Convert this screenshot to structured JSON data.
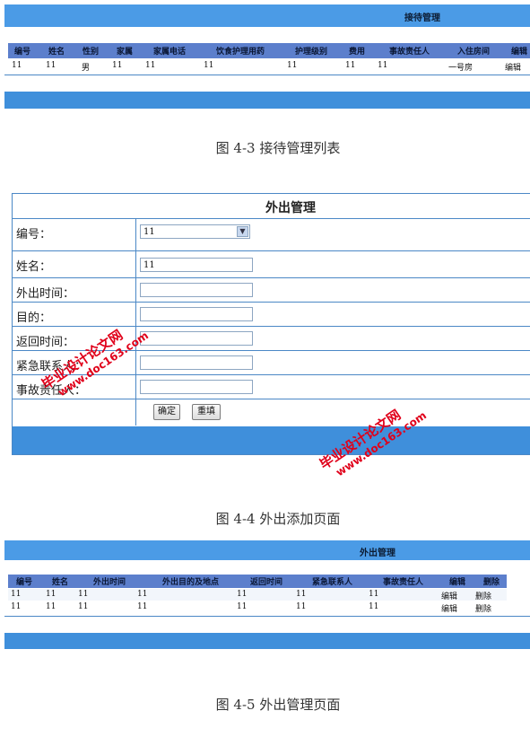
{
  "section1": {
    "title": "接待管理",
    "headers": [
      "编号",
      "姓名",
      "性别",
      "家属",
      "家属电话",
      "饮食护理用药",
      "护理级别",
      "费用",
      "事故责任人",
      "入住房间",
      "编辑"
    ],
    "rows": [
      [
        "11",
        "11",
        "男",
        "11",
        "11",
        "11",
        "11",
        "11",
        "11",
        "一号房",
        "编辑"
      ]
    ],
    "caption": "图 4-3 接待管理列表"
  },
  "section2": {
    "title": "外出管理",
    "fields": [
      {
        "label": "编号：",
        "value": "11"
      },
      {
        "label": "姓名：",
        "value": "11"
      },
      {
        "label": "外出时间：",
        "value": ""
      },
      {
        "label": "目的：",
        "value": ""
      },
      {
        "label": "返回时间：",
        "value": ""
      },
      {
        "label": "紧急联系人：",
        "value": ""
      },
      {
        "label": "事故责任人：",
        "value": ""
      }
    ],
    "confirm_label": "确定",
    "reset_label": "重填",
    "caption": "图 4-4 外出添加页面"
  },
  "section3": {
    "title": "外出管理",
    "headers": [
      "编号",
      "姓名",
      "外出时间",
      "外出目的及地点",
      "返回时间",
      "紧急联系人",
      "事故责任人",
      "编辑",
      "删除"
    ],
    "rows": [
      [
        "11",
        "11",
        "11",
        "11",
        "11",
        "11",
        "11",
        "编辑",
        "删除"
      ],
      [
        "11",
        "11",
        "11",
        "11",
        "11",
        "11",
        "11",
        "编辑",
        "删除"
      ]
    ],
    "caption": "图 4-5 外出管理页面"
  },
  "watermark": {
    "line1": "毕业设计论文网",
    "line2": "www.doc163.com",
    "color": "#e0001a"
  }
}
